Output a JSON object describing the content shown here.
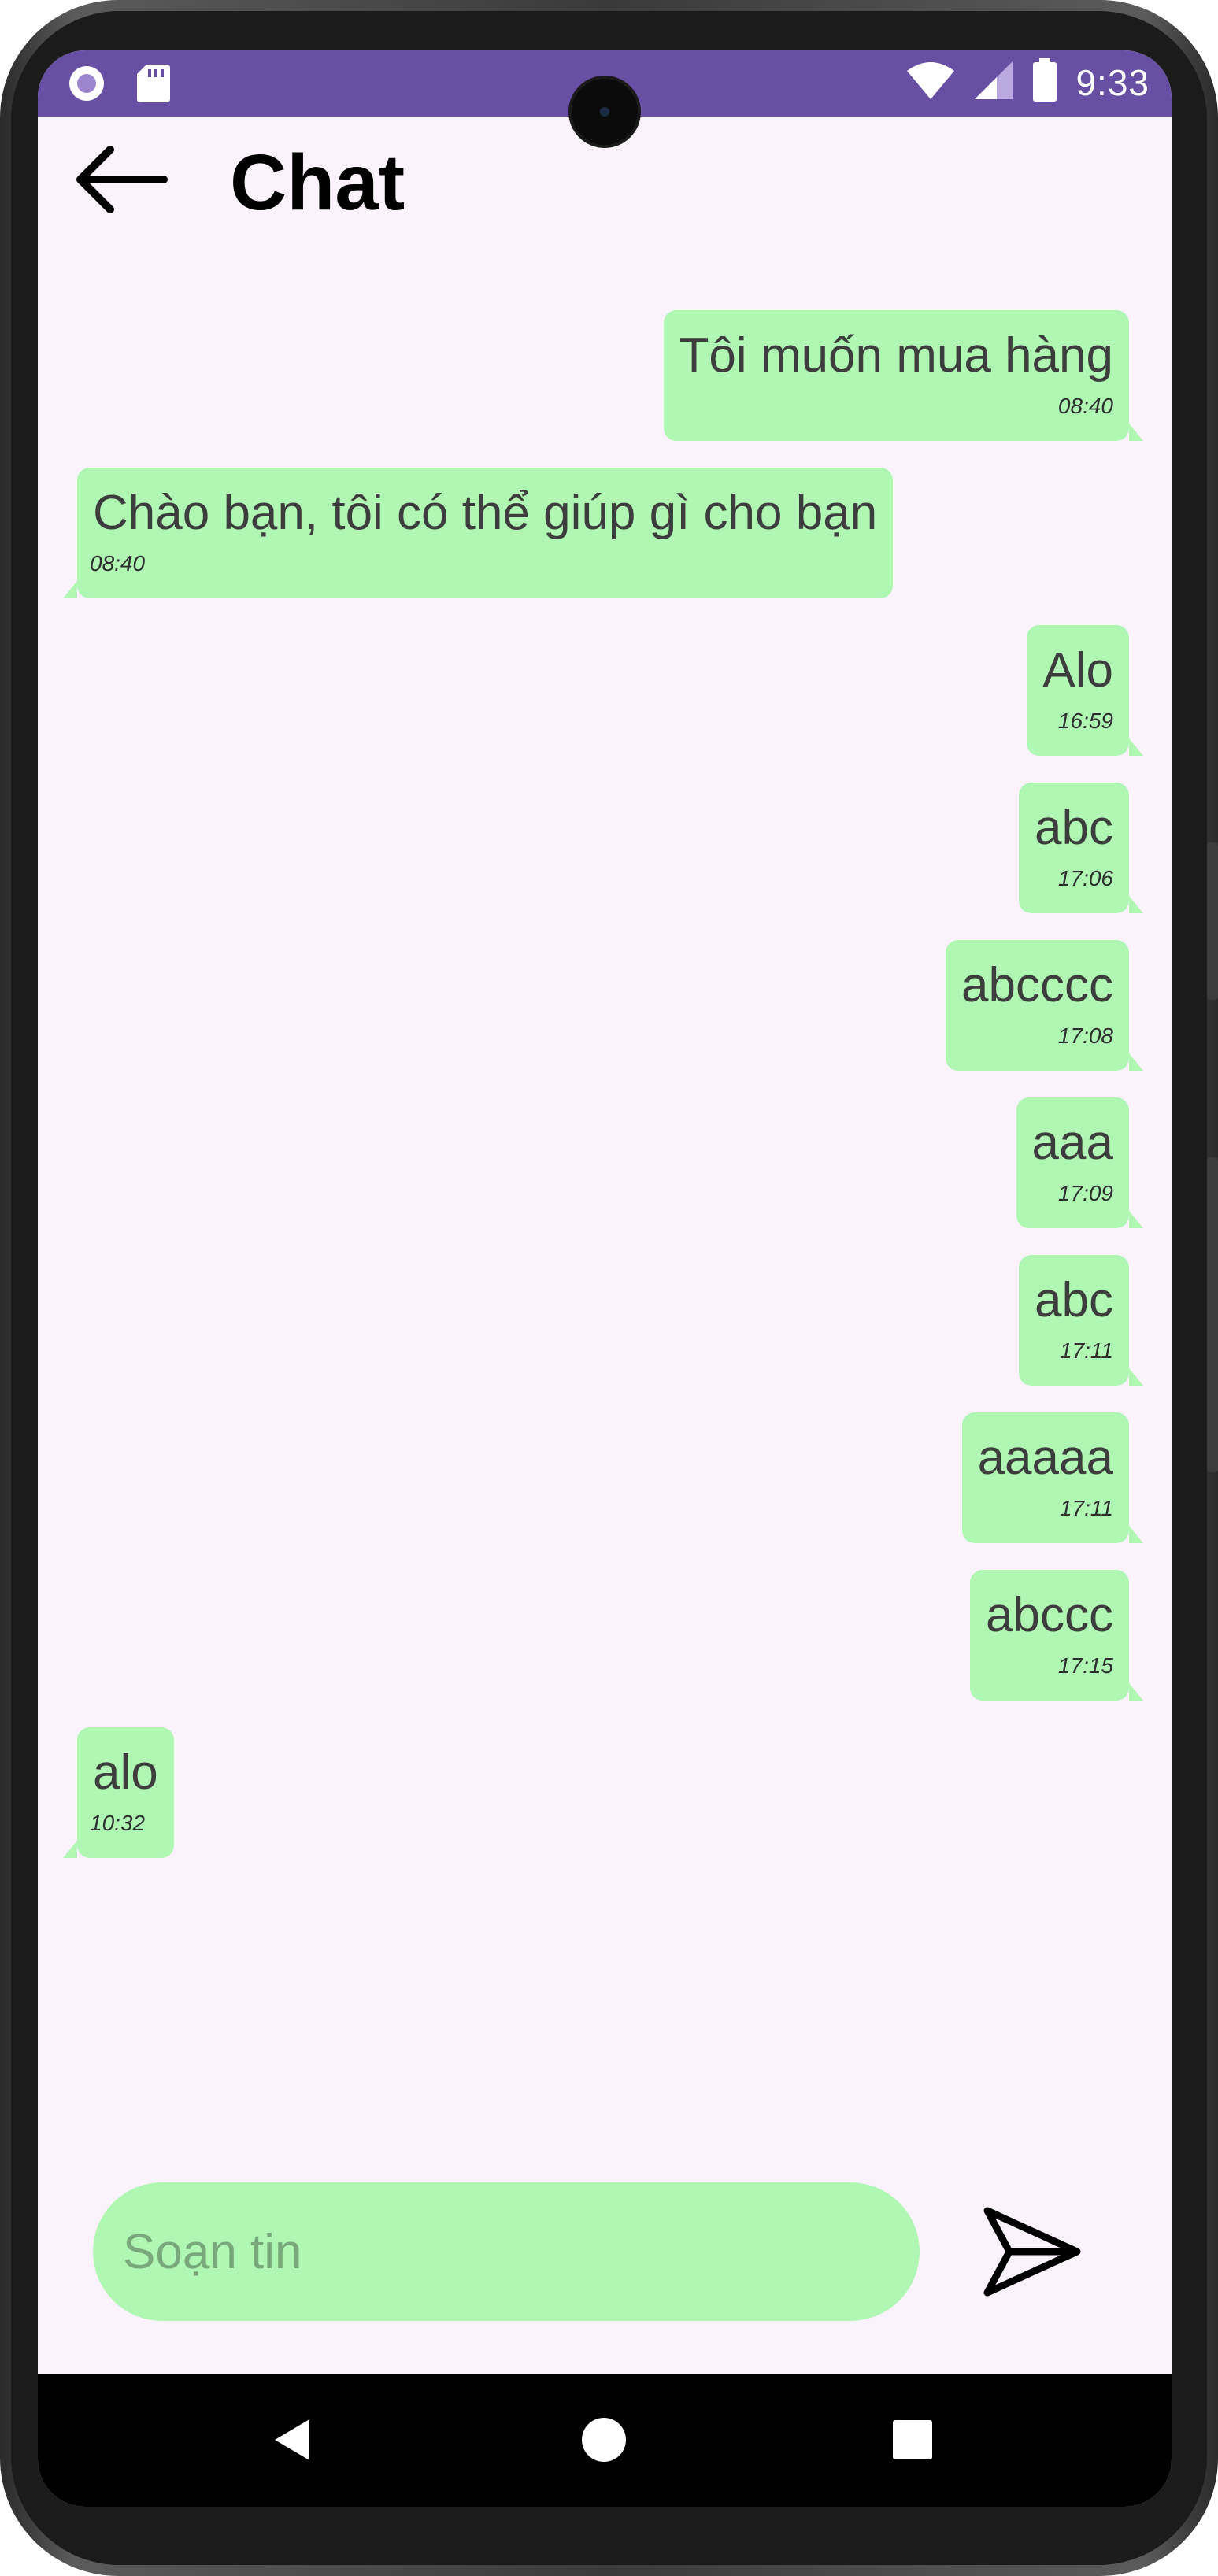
{
  "status_bar": {
    "time": "9:33",
    "icons": [
      "circle-notification-icon",
      "sd-card-icon",
      "wifi-icon",
      "cellular-signal-icon",
      "battery-icon"
    ],
    "background_color": "#6750a4"
  },
  "header": {
    "back_icon": "arrow-left-icon",
    "title": "Chat"
  },
  "messages": [
    {
      "direction": "sent",
      "text": "Tôi muốn mua hàng",
      "time": "08:40"
    },
    {
      "direction": "received",
      "text": "Chào bạn, tôi có thể giúp gì cho bạn",
      "time": "08:40"
    },
    {
      "direction": "sent",
      "text": "Alo",
      "time": "16:59"
    },
    {
      "direction": "sent",
      "text": "abc",
      "time": "17:06"
    },
    {
      "direction": "sent",
      "text": "abcccc",
      "time": "17:08"
    },
    {
      "direction": "sent",
      "text": "aaa",
      "time": "17:09"
    },
    {
      "direction": "sent",
      "text": "abc",
      "time": "17:11"
    },
    {
      "direction": "sent",
      "text": "aaaaa",
      "time": "17:11"
    },
    {
      "direction": "sent",
      "text": "abccc",
      "time": "17:15"
    },
    {
      "direction": "received",
      "text": "alo",
      "time": "10:32"
    }
  ],
  "composer": {
    "placeholder": "Soạn tin",
    "value": "",
    "send_icon": "send-icon"
  },
  "nav_bar": {
    "icons": [
      "nav-back-icon",
      "nav-home-icon",
      "nav-recents-icon"
    ]
  },
  "colors": {
    "bubble": "#aff7b2",
    "screen_background": "#fbf3fb",
    "accent": "#6750a4"
  }
}
